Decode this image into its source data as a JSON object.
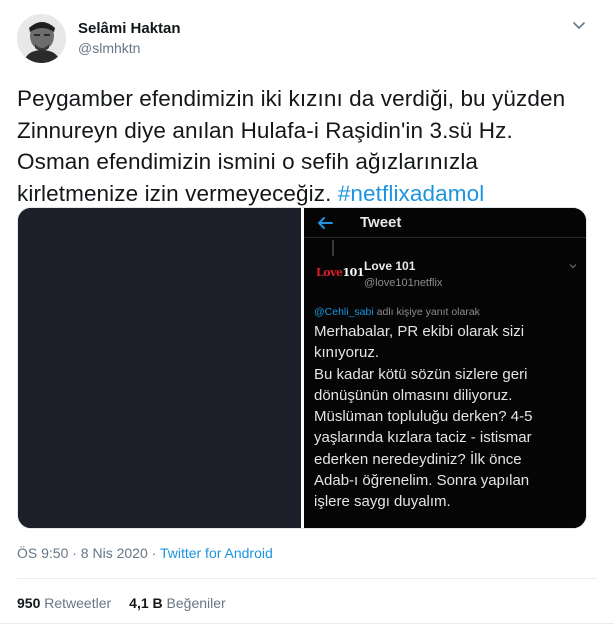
{
  "author": {
    "name": "Selâmi Haktan",
    "handle": "@slmhktn"
  },
  "tweet": {
    "lines": [
      "Peygamber efendimizin iki kızını da verdiği, bu yüzden",
      "Zinnureyn diye anılan Hulafa-i Raşidin'in 3.sü Hz.",
      "Osman efendimizin ismini o sefih ağızlarınızla",
      "kirletmenize izin vermeyeceğiz. "
    ],
    "hashtag": "#netflixadamol"
  },
  "embedded": {
    "header_title": "Tweet",
    "logo_text_red": "Love",
    "logo_text_white": "101",
    "account_name": "Love 101",
    "account_handle": "@love101netflix",
    "reply_mention": "@Cehli_sabi",
    "reply_suffix": " adlı kişiye yanıt olarak",
    "text_lines": [
      "Merhabalar, PR ekibi olarak sizi",
      "kınıyoruz.",
      "Bu kadar kötü sözün sizlere geri",
      "dönüşünün olmasını diliyoruz.",
      "Müslüman topluluğu derken? 4-5",
      "yaşlarında kızlara taciz - istismar",
      "ederken neredeydiniz? İlk önce",
      "Adab-ı öğrenelim. Sonra yapılan",
      "işlere saygı duyalım."
    ]
  },
  "meta": {
    "time_date": "ÖS 9:50 · 8 Nis 2020 · ",
    "source": "Twitter for Android"
  },
  "stats": {
    "retweets_count": "950",
    "retweets_label": " Retweetler",
    "likes_count": "4,1 B",
    "likes_label": " Beğeniler"
  },
  "colors": {
    "link": "#1b95e0",
    "secondary_text": "#657786",
    "primary_text": "#14171a"
  },
  "icons": {
    "caret": "chevron-down-icon",
    "back": "back-arrow-icon"
  }
}
